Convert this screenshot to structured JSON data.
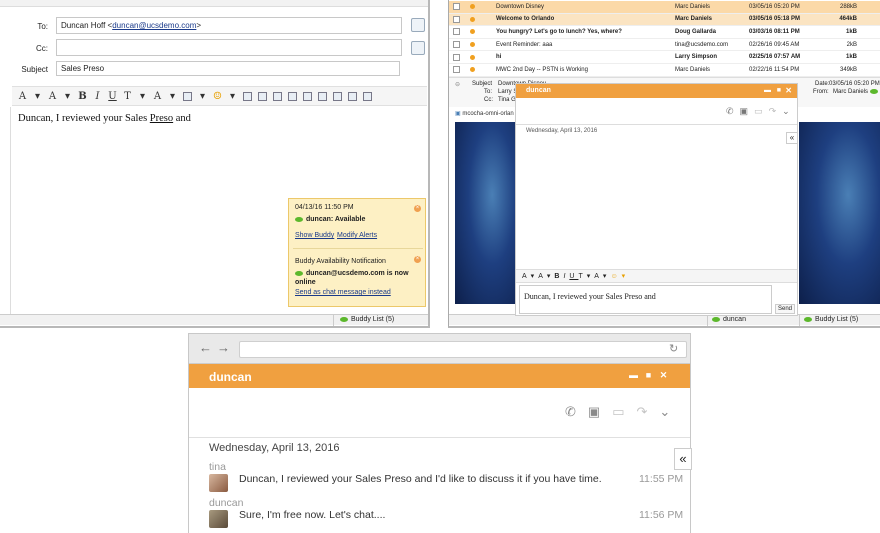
{
  "compose": {
    "to_label": "To:",
    "to_name": "Duncan Hoff <",
    "to_email": "duncan@ucsdemo.com",
    "to_close": ">",
    "cc_label": "Cc:",
    "subject_label": "Subject",
    "subject_value": "Sales Preso",
    "body_prefix": "Duncan, I reviewed your Sales ",
    "body_preso": "Preso",
    "body_suffix": " and",
    "toolbar": [
      "A",
      "A",
      "B",
      "I",
      "U",
      "T",
      "A",
      "☺"
    ],
    "status_buddy_list": "Buddy List (5)"
  },
  "notification": {
    "time": "04/13/16 11:50 PM",
    "buddy": "duncan: Available",
    "show_buddy": "Show Buddy",
    "modify_alerts": "Modify Alerts",
    "title": "Buddy Availability Notification",
    "message": "duncan@ucsdemo.com is now online",
    "send_link": "Send as chat message instead"
  },
  "maillist": {
    "rows": [
      {
        "subject": "Downtown Disney",
        "from": "Marc Daniels",
        "date": "03/05/16 05:20 PM",
        "size": "288kB",
        "bold": false
      },
      {
        "subject": "Welcome to Orlando",
        "from": "Marc Daniels",
        "date": "03/05/16 05:18 PM",
        "size": "464kB",
        "bold": true
      },
      {
        "subject": "You hungry? Let's go to lunch?  Yes, where?",
        "from": "Doug Gallarda",
        "date": "03/03/16 08:11 PM",
        "size": "1kB",
        "bold": true
      },
      {
        "subject": "Event Reminder: aaa",
        "from": "tina@ucsdemo.com",
        "date": "02/26/16 09:45 AM",
        "size": "2kB",
        "bold": false
      },
      {
        "subject": "hi",
        "from": "Larry Simpson",
        "date": "02/25/16 07:57 AM",
        "size": "1kB",
        "bold": true
      },
      {
        "subject": "MWC 2nd Day -- PSTN is Working",
        "from": "Marc Daniels",
        "date": "02/22/16 11:54 PM",
        "size": "349kB",
        "bold": false
      }
    ],
    "preview_subject_label": "Subject",
    "preview_subject": "Downtown Disney",
    "preview_to_label": "To:",
    "preview_to": "Larry S",
    "preview_cc_label": "Cc:",
    "preview_cc": "Tina G",
    "preview_date_label": "Date:",
    "preview_date": "03/05/16 05:20 PM",
    "preview_from_label": "From:",
    "preview_from": "Marc Daniels",
    "attachment": "mcocha-omni-orlan",
    "status_duncan": "duncan",
    "status_buddy_list": "Buddy List (5)"
  },
  "small_chat": {
    "title": "duncan",
    "date": "Wednesday, April 13, 2016",
    "input_text": "Duncan, I reviewed your Sales Preso and",
    "send": "Send"
  },
  "chat": {
    "title": "duncan",
    "date": "Wednesday, April 13, 2016",
    "messages": [
      {
        "name": "tina",
        "text": "Duncan, I reviewed your Sales Preso and I'd like to discuss it if you have time.",
        "time": "11:55 PM"
      },
      {
        "name": "duncan",
        "text": "Sure, I'm free now. Let's chat....",
        "time": "11:56 PM"
      }
    ],
    "collapse": "«"
  },
  "colors": {
    "accent": "#f0a040",
    "notif_bg": "#fdf0c4",
    "status_green": "#5cb82c"
  }
}
